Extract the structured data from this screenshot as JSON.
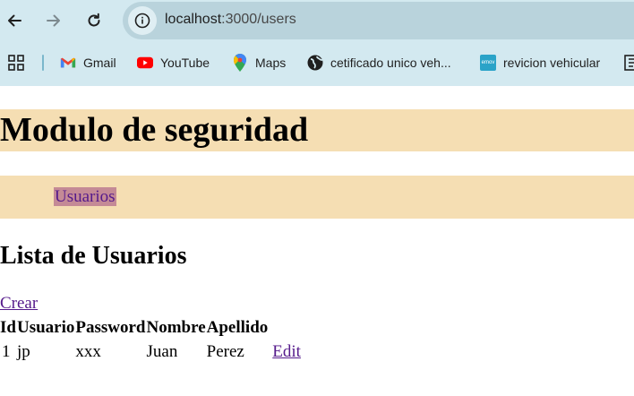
{
  "browser": {
    "url_host": "localhost",
    "url_path": ":3000/users",
    "bookmarks": [
      {
        "label": "Gmail",
        "icon": "gmail-icon"
      },
      {
        "label": "YouTube",
        "icon": "youtube-icon"
      },
      {
        "label": "Maps",
        "icon": "maps-pin-icon"
      },
      {
        "label": "cetificado unico veh...",
        "icon": "globe-icon"
      },
      {
        "label": "revicion vehicular",
        "icon": "emov-icon"
      }
    ],
    "emov_badge": "emov"
  },
  "page": {
    "title": "Modulo de seguridad",
    "nav_link": "Usuarios",
    "section_title": "Lista de Usuarios",
    "create_link": "Crear",
    "table": {
      "headers": [
        "Id",
        "Usuario",
        "Password",
        "Nombre",
        "Apellido"
      ],
      "rows": [
        {
          "id": "1",
          "usuario": "jp",
          "password": "xxx",
          "nombre": "Juan",
          "apellido": "Perez",
          "action": "Edit"
        }
      ]
    }
  },
  "colors": {
    "chrome_bg": "#d3e9f0",
    "omnibox_bg": "#b9d3dc",
    "band_bg": "#f5deb3",
    "nav_highlight": "#c48a96",
    "link": "#551a8b"
  }
}
